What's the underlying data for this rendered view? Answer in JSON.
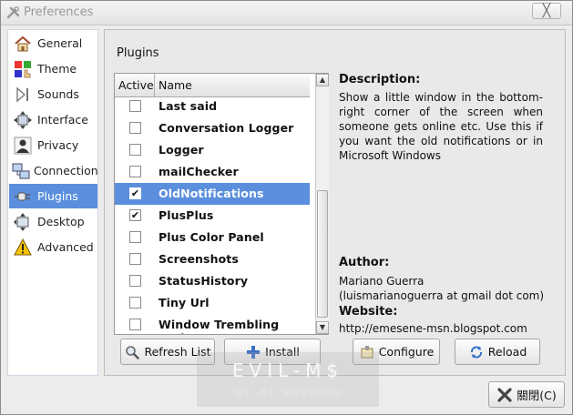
{
  "window": {
    "title": "Preferences",
    "close_label": "╳"
  },
  "sidebar": {
    "items": [
      {
        "label": "General",
        "icon": "home-icon",
        "selected": false
      },
      {
        "label": "Theme",
        "icon": "theme-icon",
        "selected": false
      },
      {
        "label": "Sounds",
        "icon": "speaker-icon",
        "selected": false
      },
      {
        "label": "Interface",
        "icon": "interface-icon",
        "selected": false
      },
      {
        "label": "Privacy",
        "icon": "person-icon",
        "selected": false
      },
      {
        "label": "Connection",
        "icon": "network-icon",
        "selected": false
      },
      {
        "label": "Plugins",
        "icon": "plug-icon",
        "selected": true
      },
      {
        "label": "Desktop",
        "icon": "desktop-icon",
        "selected": false
      },
      {
        "label": "Advanced",
        "icon": "warning-icon",
        "selected": false
      }
    ]
  },
  "plugins": {
    "heading": "Plugins",
    "columns": {
      "active": "Active",
      "name": "Name"
    },
    "rows": [
      {
        "name": "Last said",
        "active": false,
        "selected": false
      },
      {
        "name": "Conversation Logger",
        "active": false,
        "selected": false
      },
      {
        "name": "Logger",
        "active": false,
        "selected": false
      },
      {
        "name": "mailChecker",
        "active": false,
        "selected": false
      },
      {
        "name": "OldNotifications",
        "active": true,
        "selected": true
      },
      {
        "name": "PlusPlus",
        "active": true,
        "selected": false
      },
      {
        "name": "Plus Color Panel",
        "active": false,
        "selected": false
      },
      {
        "name": "Screenshots",
        "active": false,
        "selected": false
      },
      {
        "name": "StatusHistory",
        "active": false,
        "selected": false
      },
      {
        "name": "Tiny Url",
        "active": false,
        "selected": false
      },
      {
        "name": "Window Trembling Nudge",
        "active": false,
        "selected": false
      }
    ]
  },
  "details": {
    "description_label": "Description:",
    "description": "Show a little window in the bottom-right corner of the screen when someone gets online etc. Use this if you want the old notifications or in Microsoft Windows",
    "author_label": "Author:",
    "author_name": "Mariano Guerra",
    "author_email": "(luismarianoguerra at gmail dot com)",
    "website_label": "Website:",
    "website": "http://emesene-msn.blogspot.com"
  },
  "buttons": {
    "refresh": "Refresh List",
    "install": "Install",
    "configure": "Configure",
    "reload": "Reload",
    "close": "關閉(C)"
  },
  "watermark": {
    "line1": "EVIL-M$",
    "line2": "除了一樣不了解我會玩味的我"
  }
}
